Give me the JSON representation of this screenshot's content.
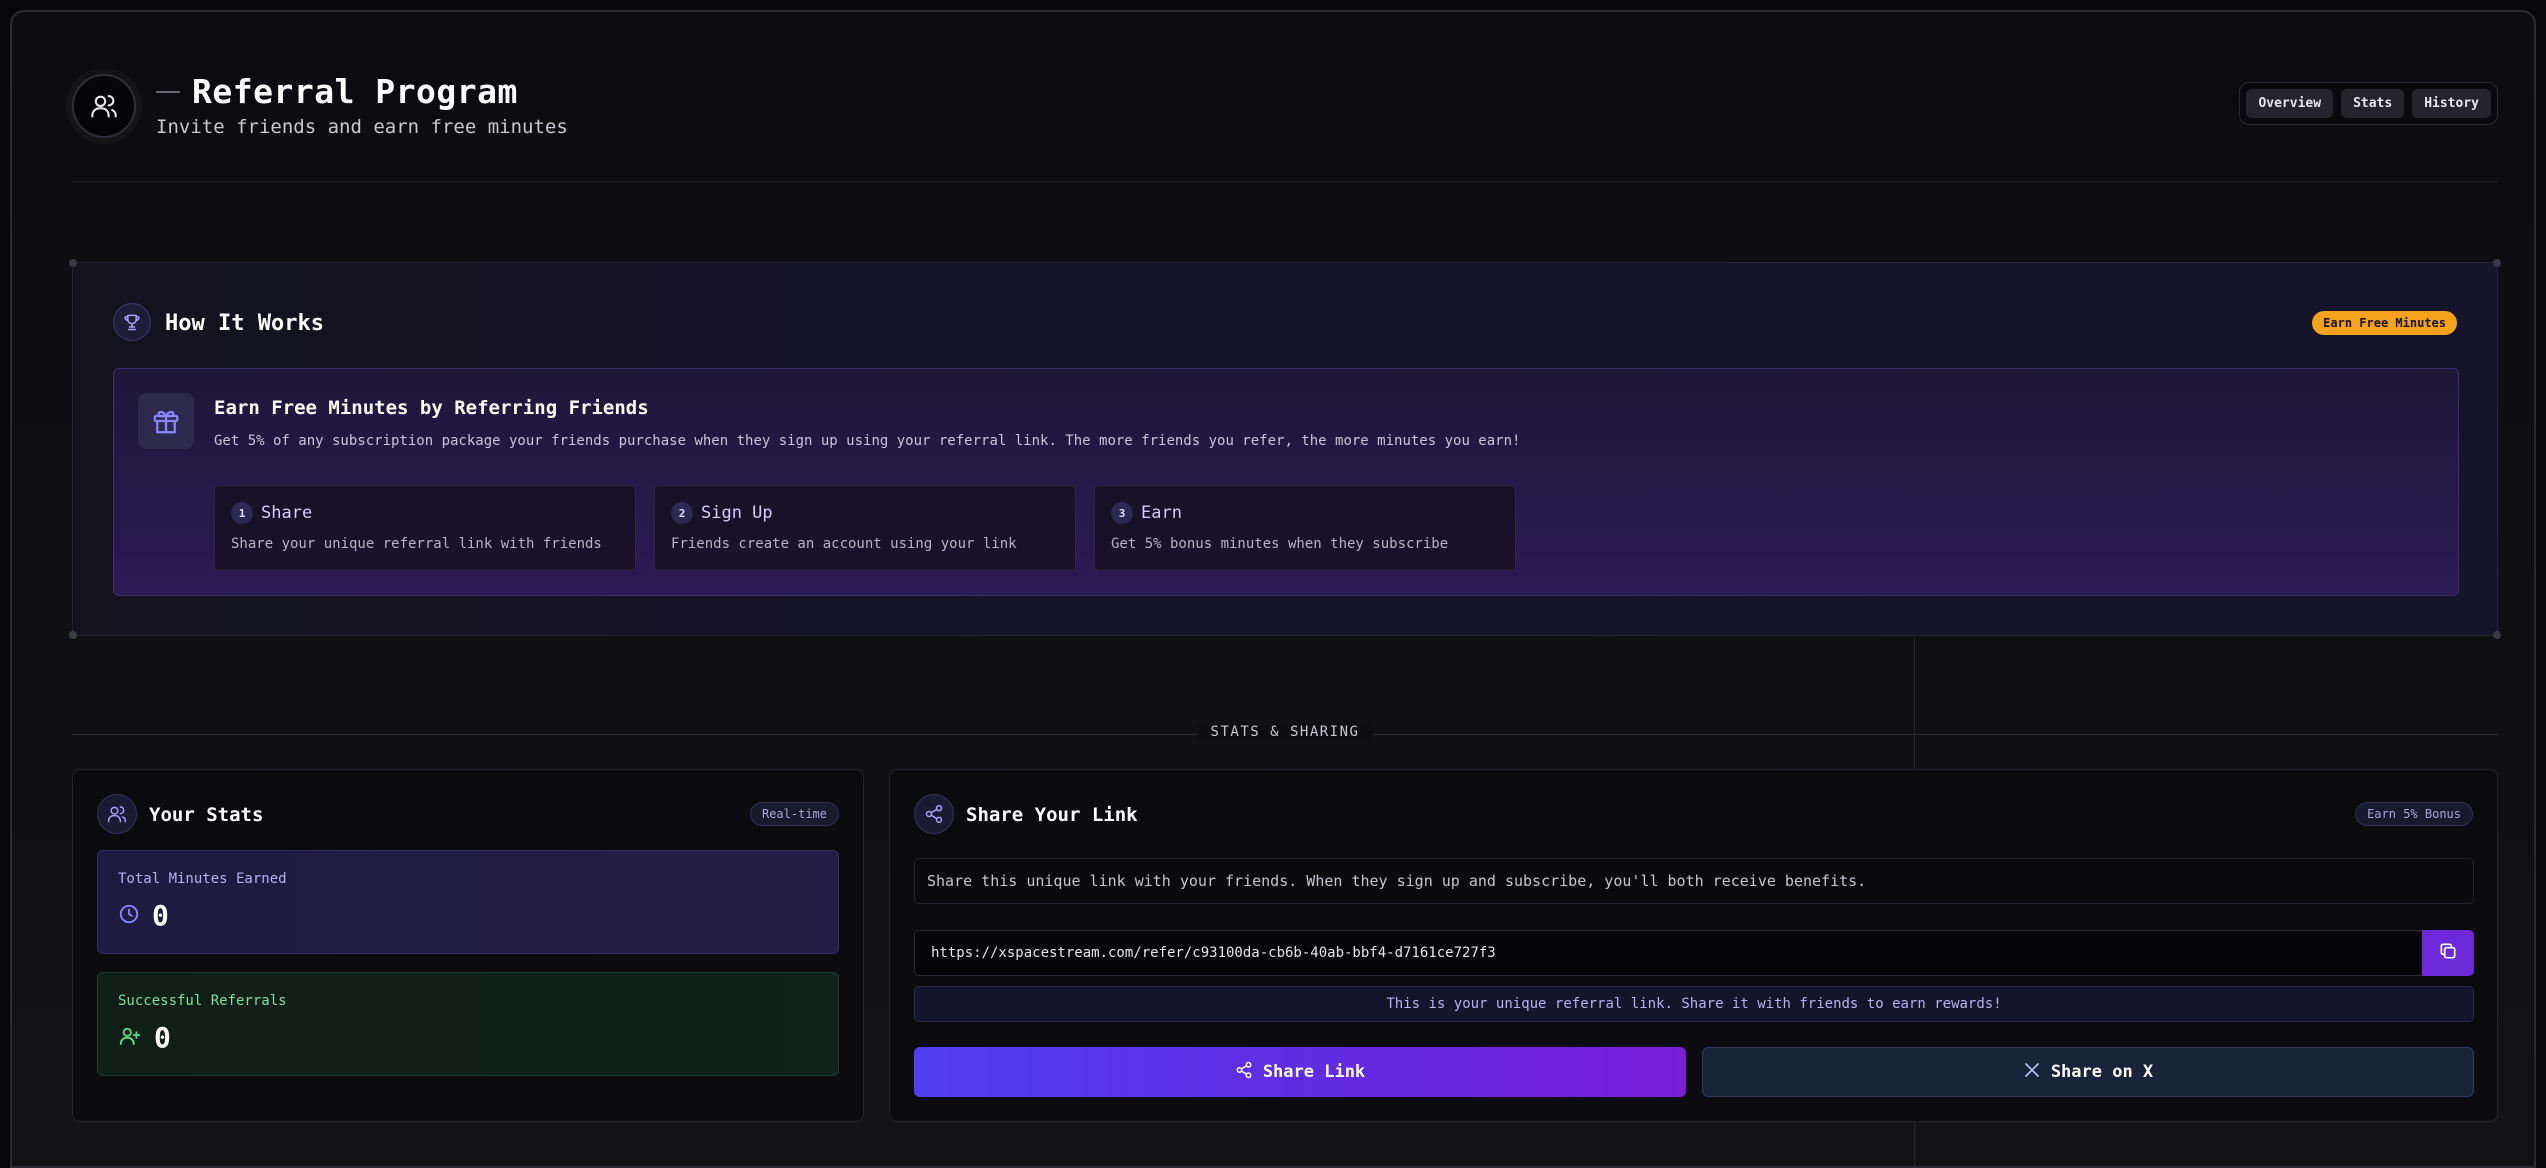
{
  "header": {
    "title": "Referral Program",
    "subtitle": "Invite friends and earn free minutes",
    "tabs": [
      "Overview",
      "Stats",
      "History"
    ]
  },
  "how_it_works": {
    "title": "How It Works",
    "badge": "Earn Free Minutes",
    "earn_title": "Earn Free Minutes by Referring Friends",
    "earn_desc": "Get 5% of any subscription package your friends purchase when they sign up using your referral link. The more friends you refer, the more minutes you earn!",
    "steps": [
      {
        "num": "1",
        "title": "Share",
        "desc": "Share your unique referral link with friends"
      },
      {
        "num": "2",
        "title": "Sign Up",
        "desc": "Friends create an account using your link"
      },
      {
        "num": "3",
        "title": "Earn",
        "desc": "Get 5% bonus minutes when they subscribe"
      }
    ]
  },
  "section_label": "STATS & SHARING",
  "stats": {
    "title": "Your Stats",
    "badge": "Real-time",
    "total_minutes_label": "Total Minutes Earned",
    "total_minutes_value": "0",
    "referrals_label": "Successful Referrals",
    "referrals_value": "0"
  },
  "share": {
    "title": "Share Your Link",
    "badge": "Earn 5% Bonus",
    "desc": "Share this unique link with your friends. When they sign up and subscribe, you'll both receive benefits.",
    "url": "https://xspacestream.com/refer/c93100da-cb6b-40ab-bbf4-d7161ce727f3",
    "note": "This is your unique referral link. Share it with friends to earn rewards!",
    "share_button": "Share Link",
    "x_button": "Share on X"
  },
  "icons": {
    "header": "users-icon",
    "how_it_works": "trophy-icon",
    "earn": "gift-icon",
    "stats": "users-icon",
    "share": "share-icon",
    "minutes": "clock-icon",
    "referrals": "user-plus-icon",
    "copy": "copy-icon",
    "x": "x-logo-icon"
  },
  "colors": {
    "accent_purple": "#6d28d9",
    "badge_orange": "#f3a31b",
    "green_label": "#7fe0a0"
  }
}
